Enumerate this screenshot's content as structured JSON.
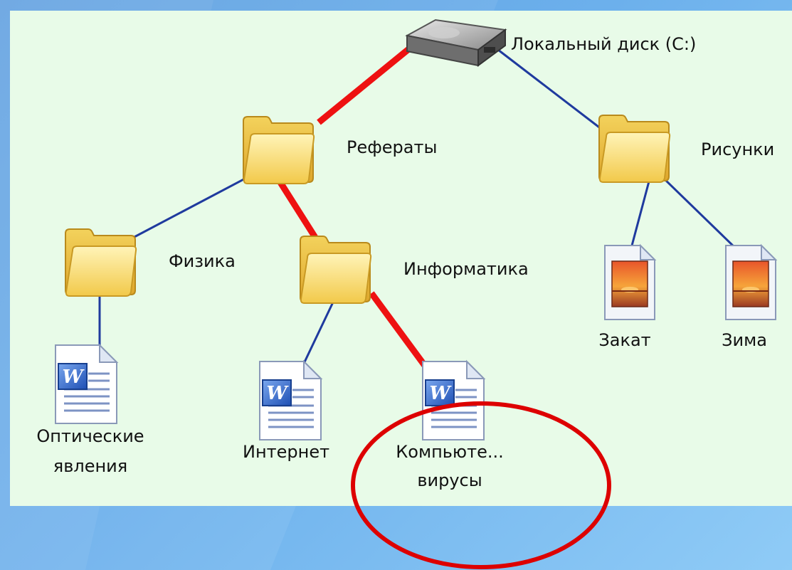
{
  "colors": {
    "panel_background": "#e8fbe8",
    "tree_line": "#1f3a9e",
    "highlight_path": "#ee1111",
    "highlight_circle": "#dd0000"
  },
  "tree": {
    "root": {
      "label": "Локальный диск (C:)",
      "icon": "hard-drive-icon"
    },
    "nodes": [
      {
        "label": "Рефераты",
        "icon": "folder-icon",
        "parent": "Локальный диск (C:)"
      },
      {
        "label": "Рисунки",
        "icon": "folder-icon",
        "parent": "Локальный диск (C:)"
      },
      {
        "label": "Физика",
        "icon": "folder-icon",
        "parent": "Рефераты"
      },
      {
        "label": "Информатика",
        "icon": "folder-icon",
        "parent": "Рефераты"
      },
      {
        "label_lines": [
          "Оптические",
          "явления"
        ],
        "icon": "word-document-icon",
        "parent": "Физика"
      },
      {
        "label": "Интернет",
        "icon": "word-document-icon",
        "parent": "Информатика"
      },
      {
        "label_lines": [
          "Компьюте...",
          "вирусы"
        ],
        "icon": "word-document-icon",
        "parent": "Информатика"
      },
      {
        "label": "Закат",
        "icon": "image-file-icon",
        "parent": "Рисунки"
      },
      {
        "label": "Зима",
        "icon": "image-file-icon",
        "parent": "Рисунки"
      }
    ],
    "highlighted_path": [
      "Локальный диск (C:)",
      "Рефераты",
      "Информатика",
      "Компьюте... вирусы"
    ]
  },
  "labels": {
    "disk": "Локальный диск (C:)",
    "referaty": "Рефераты",
    "risunki": "Рисунки",
    "fizika": "Физика",
    "informatika": "Информатика",
    "optics_line1": "Оптические",
    "optics_line2": "явления",
    "internet": "Интернет",
    "virus_line1": "Компьюте...",
    "virus_line2": "вирусы",
    "zakat": "Закат",
    "zima": "Зима"
  }
}
